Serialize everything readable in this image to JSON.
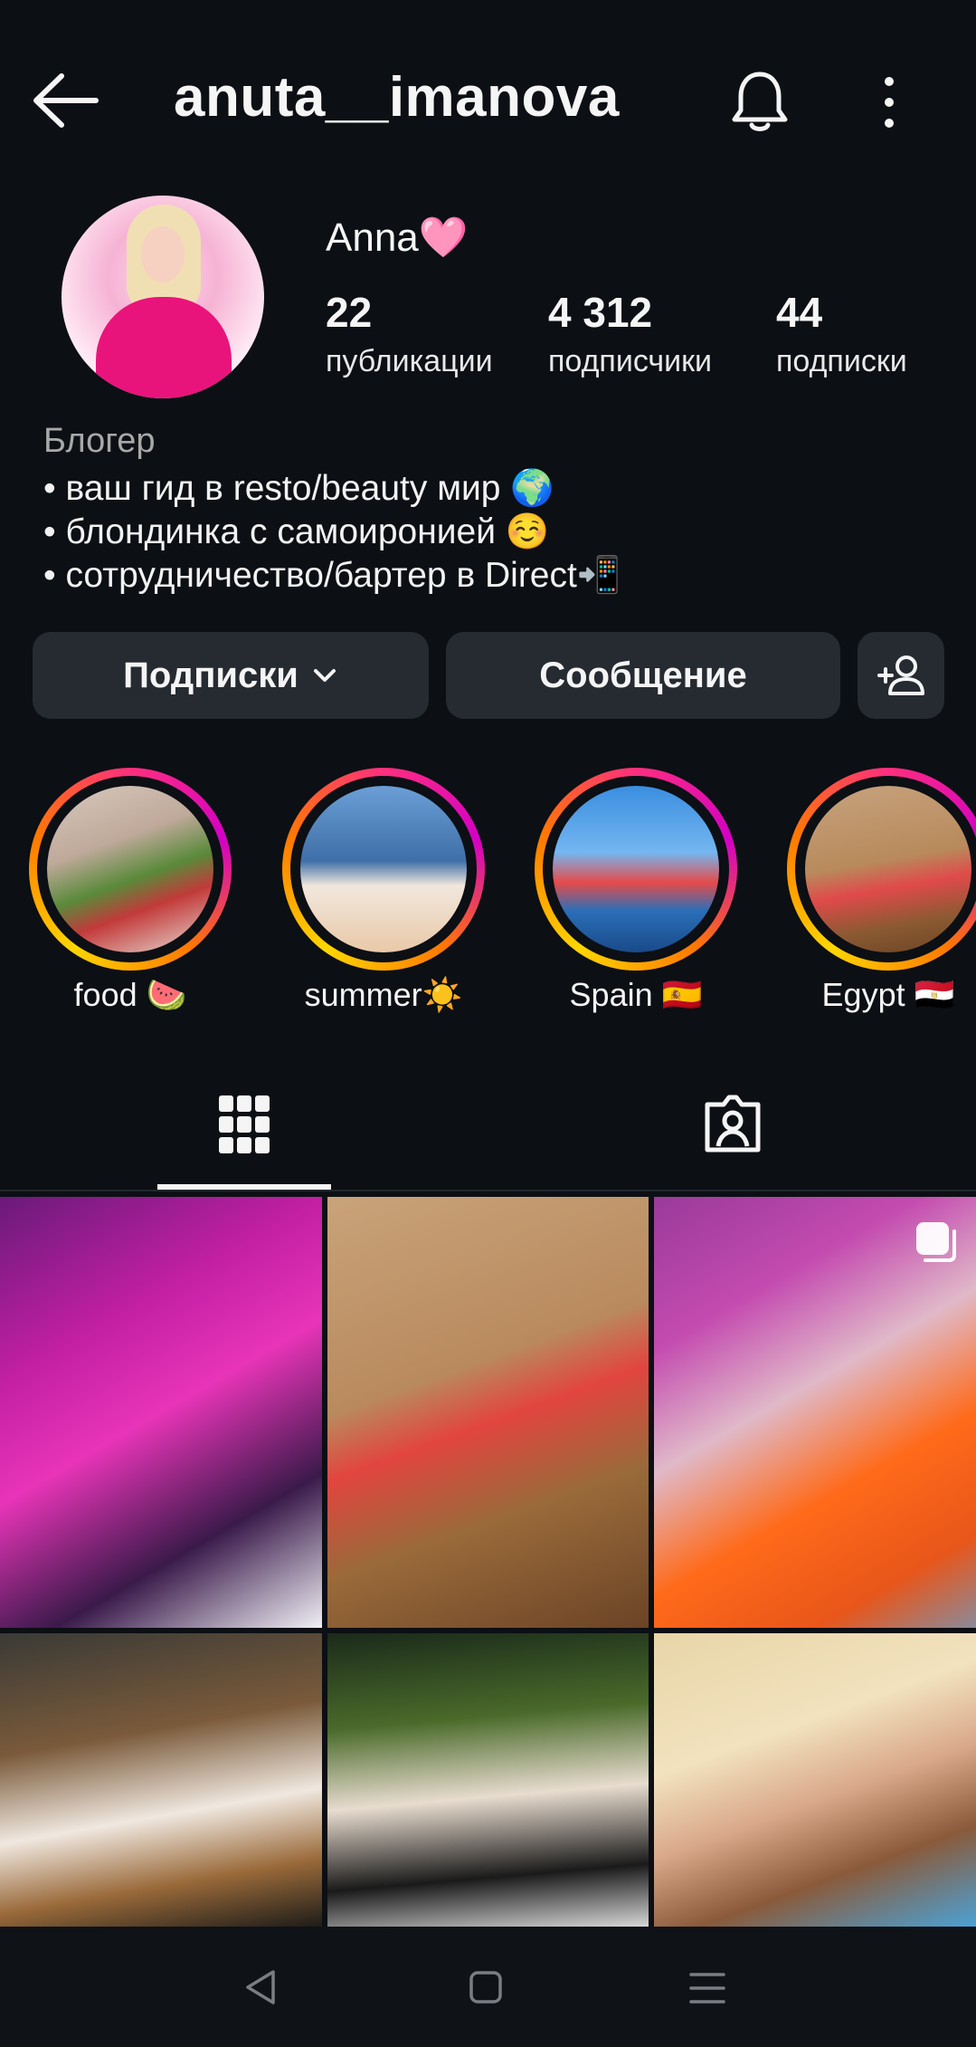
{
  "header": {
    "username": "anuta__imanova",
    "icons": [
      "back-arrow-icon",
      "bell-icon",
      "more-vertical-icon"
    ]
  },
  "profile": {
    "display_name": "Anna🩷",
    "stats": [
      {
        "value": "22",
        "label": "публикации"
      },
      {
        "value": "4 312",
        "label": "подписчики"
      },
      {
        "value": "44",
        "label": "подписки"
      }
    ],
    "category": "Блогер",
    "bio": [
      "• ваш гид в resto/beauty мир 🌍",
      "• блондинка с самоиронией ☺️",
      "• сотрудничество/бартер в Direct📲"
    ]
  },
  "actions": {
    "following_label": "Подписки",
    "message_label": "Сообщение",
    "icons": [
      "chevron-down-icon",
      "add-person-icon"
    ]
  },
  "highlights": [
    {
      "label": "food 🍉"
    },
    {
      "label": "summer☀️"
    },
    {
      "label": "Spain 🇪🇸"
    },
    {
      "label": "Egypt 🇪🇬"
    }
  ],
  "tabs": {
    "items": [
      "grid-icon",
      "tagged-icon"
    ],
    "active": "grid-icon"
  },
  "colors": {
    "background": "#0c0f14",
    "button": "#262a31",
    "story_ring": [
      "#ff2f7e",
      "#d300c5",
      "#ff7a00",
      "#ffd600"
    ]
  },
  "system_nav": [
    "nav-back-icon",
    "nav-home-icon",
    "nav-menu-icon"
  ]
}
